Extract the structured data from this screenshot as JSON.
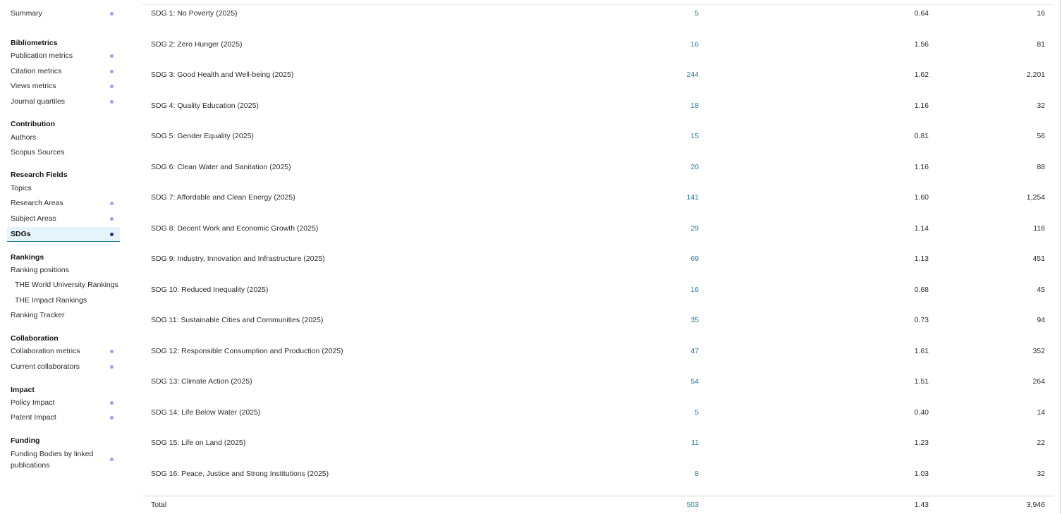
{
  "sidebar": {
    "summary": "Summary",
    "sections": {
      "bibliometrics": "Bibliometrics",
      "contribution": "Contribution",
      "research_fields": "Research Fields",
      "rankings": "Rankings",
      "collaboration": "Collaboration",
      "impact": "Impact",
      "funding": "Funding"
    },
    "items": {
      "publication_metrics": "Publication metrics",
      "citation_metrics": "Citation metrics",
      "views_metrics": "Views metrics",
      "journal_quartiles": "Journal quartiles",
      "authors": "Authors",
      "scopus_sources": "Scopus Sources",
      "topics": "Topics",
      "research_areas": "Research Areas",
      "subject_areas": "Subject Areas",
      "sdgs": "SDGs",
      "ranking_positions": "Ranking positions",
      "the_world_university_rankings": "THE World University Rankings",
      "the_impact_rankings": "THE Impact Rankings",
      "ranking_tracker": "Ranking Tracker",
      "collaboration_metrics": "Collaboration metrics",
      "current_collaborators": "Current collaborators",
      "policy_impact": "Policy Impact",
      "patent_impact": "Patent Impact",
      "funding_bodies": "Funding Bodies by linked publications"
    },
    "accent_dot_color": "#bf8ff0",
    "active_dot_color": "#3a2580",
    "active_bg_color": "#e4f4fa"
  },
  "table": {
    "link_color": "#2e7f9a",
    "rows": [
      {
        "name": "SDG 1: No Poverty (2025)",
        "count": "5",
        "fwci": "0.64",
        "citations": "16"
      },
      {
        "name": "SDG 2: Zero Hunger (2025)",
        "count": "16",
        "fwci": "1.56",
        "citations": "81"
      },
      {
        "name": "SDG 3: Good Health and Well-being (2025)",
        "count": "244",
        "fwci": "1.62",
        "citations": "2,201"
      },
      {
        "name": "SDG 4: Quality Education (2025)",
        "count": "18",
        "fwci": "1.16",
        "citations": "32"
      },
      {
        "name": "SDG 5: Gender Equality (2025)",
        "count": "15",
        "fwci": "0.81",
        "citations": "56"
      },
      {
        "name": "SDG 6: Clean Water and Sanitation (2025)",
        "count": "20",
        "fwci": "1.16",
        "citations": "88"
      },
      {
        "name": "SDG 7: Affordable and Clean Energy (2025)",
        "count": "141",
        "fwci": "1.60",
        "citations": "1,254"
      },
      {
        "name": "SDG 8: Decent Work and Economic Growth (2025)",
        "count": "29",
        "fwci": "1.14",
        "citations": "116"
      },
      {
        "name": "SDG 9: Industry, Innovation and Infrastructure (2025)",
        "count": "69",
        "fwci": "1.13",
        "citations": "451"
      },
      {
        "name": "SDG 10: Reduced Inequality (2025)",
        "count": "16",
        "fwci": "0.68",
        "citations": "45"
      },
      {
        "name": "SDG 11: Sustainable Cities and Communities (2025)",
        "count": "35",
        "fwci": "0.73",
        "citations": "94"
      },
      {
        "name": "SDG 12: Responsible Consumption and Production (2025)",
        "count": "47",
        "fwci": "1.61",
        "citations": "352"
      },
      {
        "name": "SDG 13: Climate Action (2025)",
        "count": "54",
        "fwci": "1.51",
        "citations": "264"
      },
      {
        "name": "SDG 14: Life Below Water (2025)",
        "count": "5",
        "fwci": "0.40",
        "citations": "14"
      },
      {
        "name": "SDG 15: Life on Land (2025)",
        "count": "11",
        "fwci": "1.23",
        "citations": "22"
      },
      {
        "name": "SDG 16: Peace, Justice and Strong Institutions (2025)",
        "count": "8",
        "fwci": "1.03",
        "citations": "32"
      }
    ],
    "total": {
      "name": "Total",
      "count": "503",
      "fwci": "1.43",
      "citations": "3,946"
    }
  }
}
